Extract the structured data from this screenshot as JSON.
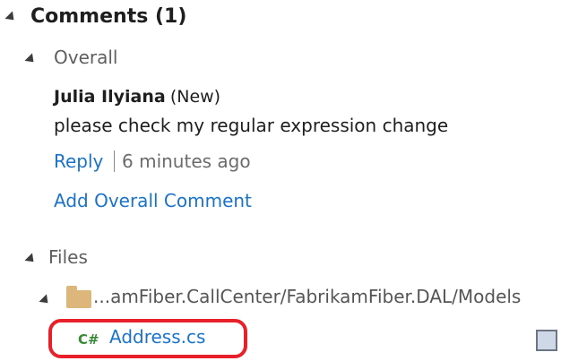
{
  "comments": {
    "header": "Comments (1)",
    "overall": {
      "label": "Overall",
      "comment": {
        "author": "Julia Ilyiana",
        "status": "(New)",
        "text": "please check my regular expression change",
        "reply_label": "Reply",
        "timestamp": "6 minutes ago"
      },
      "add_comment_label": "Add Overall Comment"
    },
    "files": {
      "label": "Files",
      "folder_path": "...amFiber.CallCenter/FabrikamFiber.DAL/Models",
      "file": {
        "type_badge": "C#",
        "name": "Address.cs"
      }
    }
  },
  "colors": {
    "link": "#1a73c9",
    "highlight": "#e8202a",
    "csharp_badge": "#388a34",
    "folder": "#dcb67a"
  }
}
